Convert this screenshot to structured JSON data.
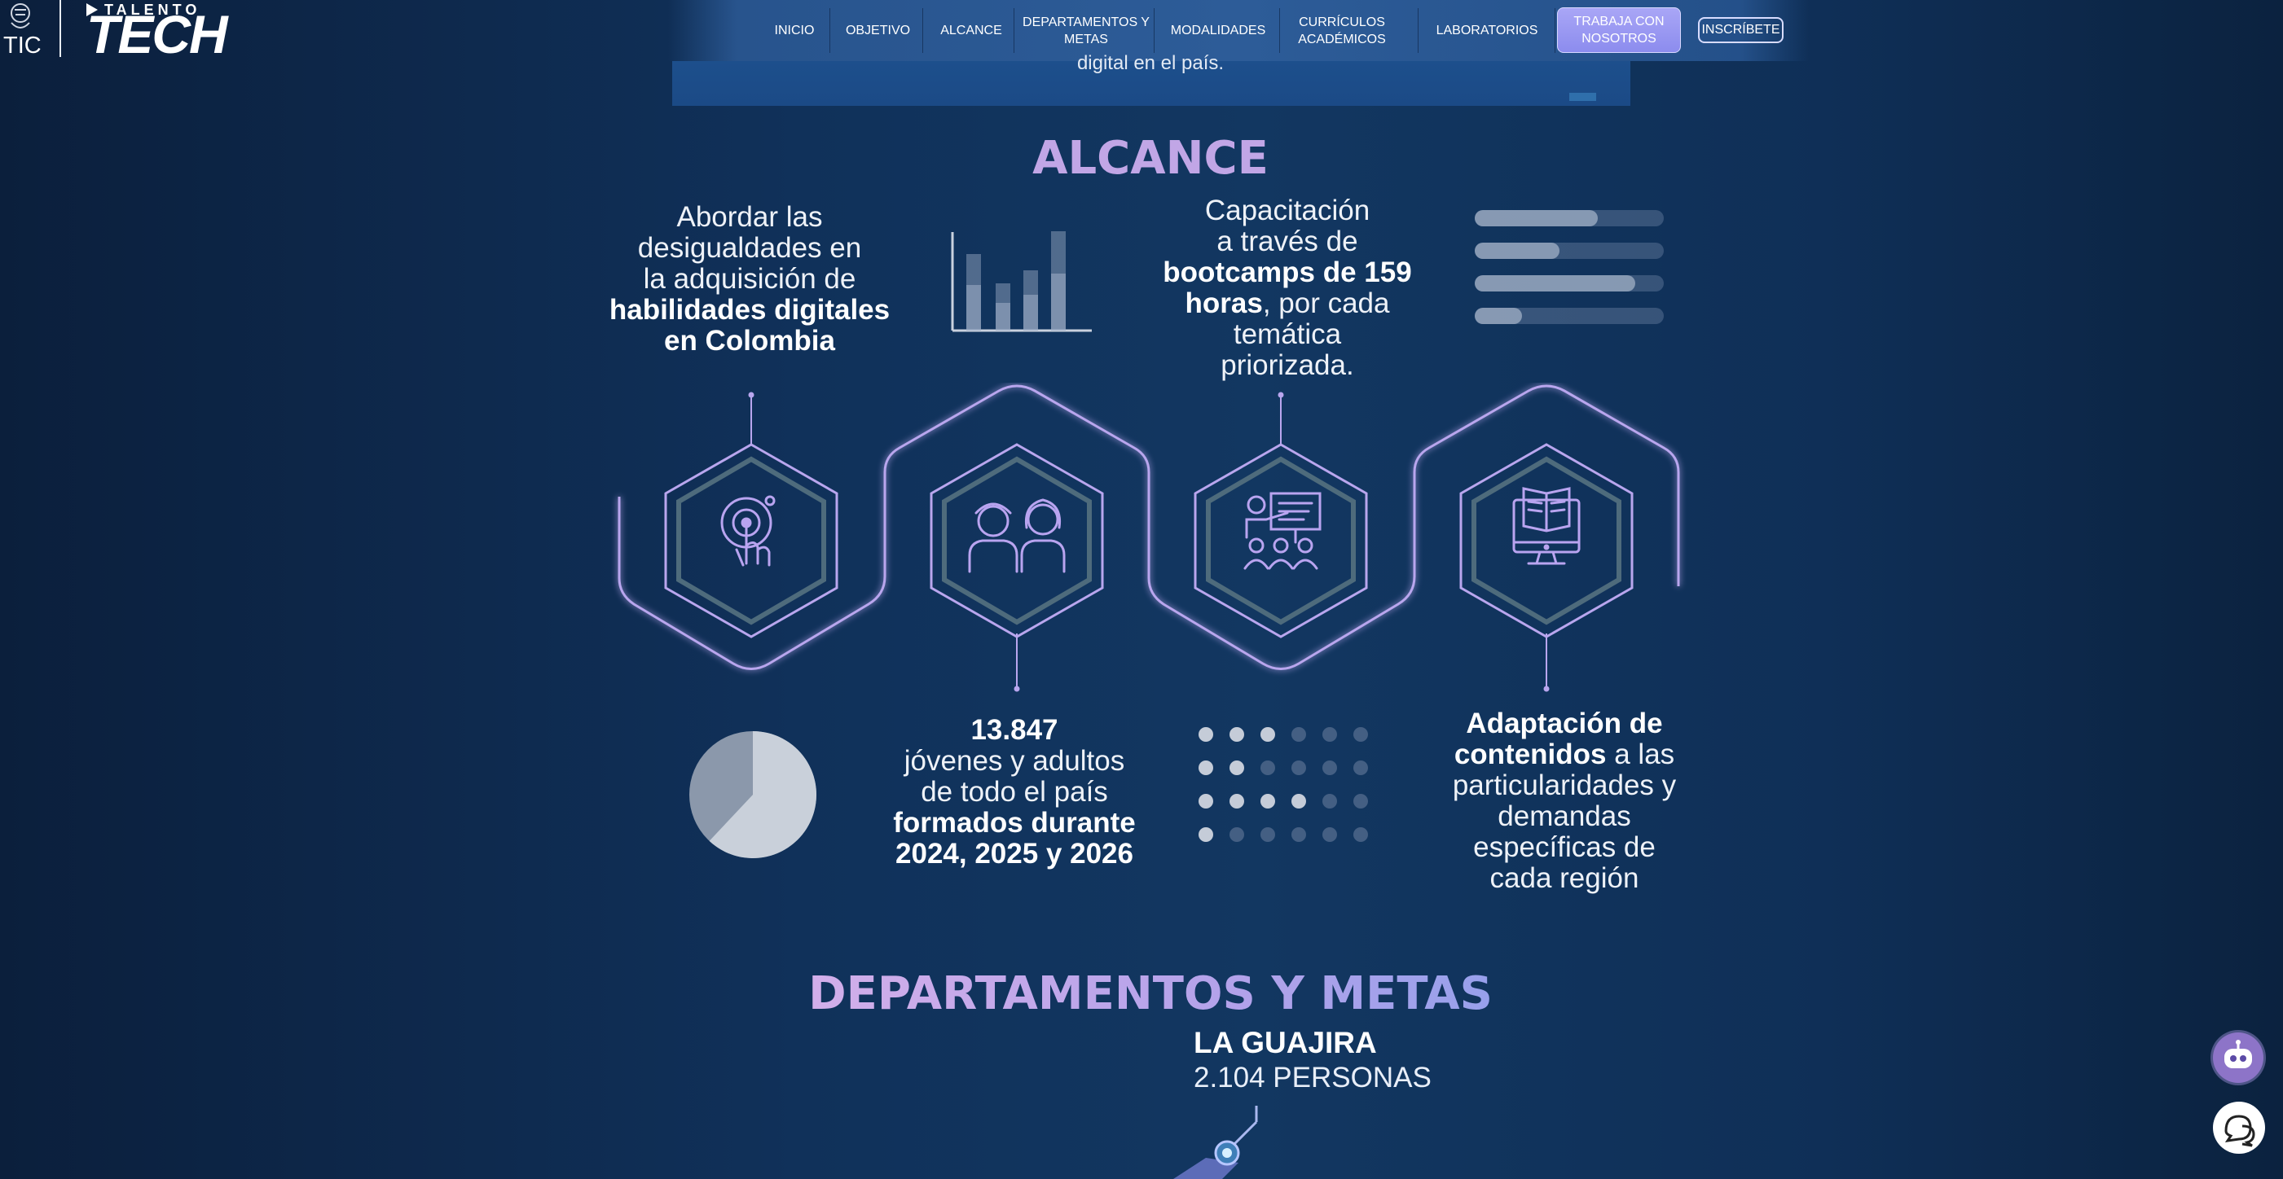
{
  "header": {
    "logo_tic_text": "TIC",
    "logo_talento": "TALENTO",
    "logo_tech": "TECH",
    "nav": [
      {
        "label": "INICIO"
      },
      {
        "label": "OBJETIVO"
      },
      {
        "label": "ALCANCE"
      },
      {
        "label": "DEPARTAMENTOS Y METAS"
      },
      {
        "label": "MODALIDADES"
      },
      {
        "label": "CURRÍCULOS ACADÉMICOS"
      },
      {
        "label": "LABORATORIOS"
      }
    ],
    "trabaja_label": "TRABAJA CON NOSOTROS",
    "inscribete_label": "INSCRÍBETE"
  },
  "banner": {
    "text": "digital en el país."
  },
  "alcance": {
    "title": "ALCANCE",
    "cards": [
      {
        "lines": [
          "Abordar las",
          "desigualdades en",
          "la adquisición de"
        ],
        "bold": [
          "habilidades digitales",
          "en Colombia"
        ],
        "icon": "touch-target-icon"
      },
      {
        "bold_top": "13.847",
        "lines": [
          "jóvenes y adultos",
          "de todo el país"
        ],
        "bold": [
          "formados durante",
          "2024, 2025 y 2026"
        ],
        "icon": "students-icon"
      },
      {
        "lines_top": [
          "Capacitación",
          "a través de"
        ],
        "bold_mid": [
          "bootcamps de 159",
          "horas"
        ],
        "tail": ", por cada",
        "lines": [
          "temática",
          "priorizada."
        ],
        "icon": "teacher-presentation-icon"
      },
      {
        "bold": [
          "Adaptación de",
          "contenidos"
        ],
        "tail": " a las",
        "lines": [
          "particularidades y",
          "demandas",
          "específicas de",
          "cada región"
        ],
        "icon": "computer-book-icon"
      }
    ],
    "decor": {
      "progress_levels": [
        0.65,
        0.45,
        0.85,
        0.25
      ],
      "pie_fraction": 0.62,
      "dot_grid_lit": [
        3,
        2,
        4,
        1
      ]
    }
  },
  "departamentos": {
    "title": "DEPARTAMENTOS Y METAS",
    "region": "LA GUAJIRA",
    "value": "2.104 PERSONAS"
  },
  "colors": {
    "background": "#10315a",
    "accent_purple": "#c1a6e6",
    "hex_stroke": "#b9a6ee",
    "icon_stroke": "#b9a4f0"
  },
  "widgets": {
    "chatbot_icon": "robot-chat-icon",
    "help_icon": "help-chat-icon"
  }
}
